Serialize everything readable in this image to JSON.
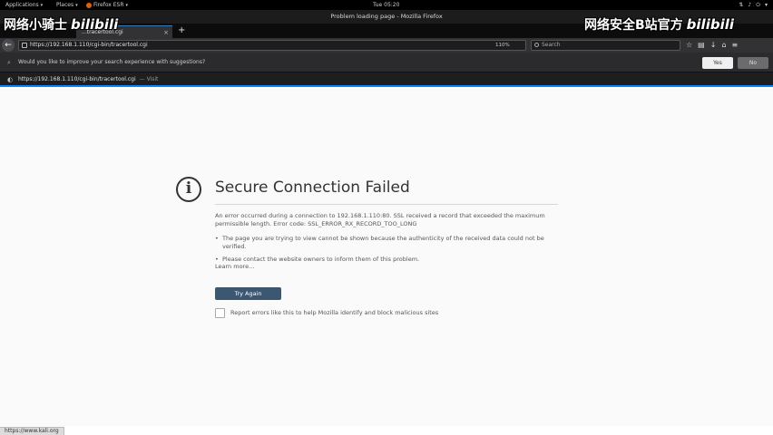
{
  "gnome_bar": {
    "applications": "Applications",
    "places": "Places",
    "active_app": "Firefox ESR",
    "clock": "Tue 05:20"
  },
  "window": {
    "title": "Problem loading page - Mozilla Firefox"
  },
  "tab": {
    "label": "...tracertool.cgi"
  },
  "navbar": {
    "url": "https://192.168.1.110/cgi-bin/tracertool.cgi",
    "zoom": "110%",
    "search_placeholder": "Search"
  },
  "notification": {
    "text": "Would you like to improve your search experience with suggestions?",
    "yes_label": "Yes",
    "no_label": "No"
  },
  "url_suggestion": {
    "url": "https://192.168.1.110/cgi-bin/tracertool.cgi",
    "action": "— Visit"
  },
  "watermark": {
    "left_text": "网络小骑士",
    "right_text": "网络安全B站官方",
    "logo": "bilibili"
  },
  "error_page": {
    "title": "Secure Connection Failed",
    "description": "An error occurred during a connection to 192.168.1.110:80. SSL received a record that exceeded the maximum permissible length. Error code: SSL_ERROR_RX_RECORD_TOO_LONG",
    "bullets": [
      "The page you are trying to view cannot be shown because the authenticity of the received data could not be verified.",
      "Please contact the website owners to inform them of this problem."
    ],
    "learn_more": "Learn more...",
    "try_again": "Try Again",
    "report_label": "Report errors like this to help Mozilla identify and block malicious sites"
  },
  "status": {
    "text": "https://www.kali.org"
  },
  "colors": {
    "accent": "#0a84ff",
    "try_again_button": "#3b5772"
  }
}
